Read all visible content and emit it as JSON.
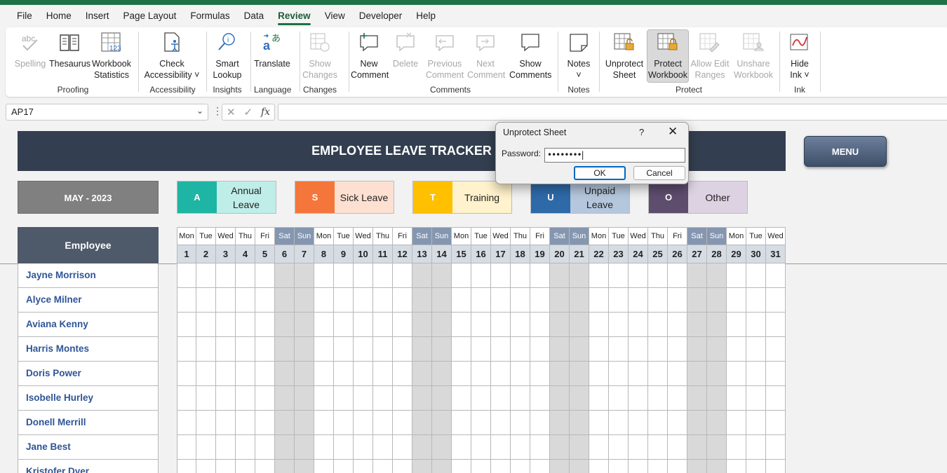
{
  "menu": [
    "File",
    "Home",
    "Insert",
    "Page Layout",
    "Formulas",
    "Data",
    "Review",
    "View",
    "Developer",
    "Help"
  ],
  "active_tab": "Review",
  "ribbon": {
    "spelling": [
      "Spelling"
    ],
    "thesaurus": [
      "Thesaurus"
    ],
    "workbook_stats": [
      "Workbook",
      "Statistics"
    ],
    "check_accessibility": [
      "Check",
      "Accessibility ˅"
    ],
    "smart_lookup": [
      "Smart",
      "Lookup"
    ],
    "translate": [
      "Translate"
    ],
    "show_changes": [
      "Show",
      "Changes"
    ],
    "new_comment": [
      "New",
      "Comment"
    ],
    "delete": [
      "Delete"
    ],
    "previous_comment": [
      "Previous",
      "Comment"
    ],
    "next_comment": [
      "Next",
      "Comment"
    ],
    "show_comments": [
      "Show",
      "Comments"
    ],
    "notes": [
      "Notes",
      "˅"
    ],
    "unprotect_sheet": [
      "Unprotect",
      "Sheet"
    ],
    "protect_workbook": [
      "Protect",
      "Workbook"
    ],
    "allow_edit_ranges": [
      "Allow Edit",
      "Ranges"
    ],
    "unshare_workbook": [
      "Unshare",
      "Workbook"
    ],
    "hide_ink": [
      "Hide",
      "Ink ˅"
    ],
    "groups": {
      "proofing": "Proofing",
      "accessibility": "Accessibility",
      "insights": "Insights",
      "language": "Language",
      "changes": "Changes",
      "comments": "Comments",
      "notes": "Notes",
      "protect": "Protect",
      "ink": "Ink"
    }
  },
  "formula_bar": {
    "name_box": "AP17",
    "formula": ""
  },
  "sheet": {
    "title": "EMPLOYEE LEAVE TRACKER",
    "menu_button": "MENU",
    "month": "MAY - 2023",
    "legend": [
      {
        "code": "A",
        "label": "Annual Leave",
        "code_color": "#1fb5a4",
        "label_color": "#bfeee8"
      },
      {
        "code": "S",
        "label": "Sick Leave",
        "code_color": "#f4763a",
        "label_color": "#fde0d2"
      },
      {
        "code": "T",
        "label": "Training",
        "code_color": "#ffc000",
        "label_color": "#fff2cc"
      },
      {
        "code": "U",
        "label": "Unpaid Leave",
        "code_color": "#2e6aa8",
        "label_color": "#b4c7dc"
      },
      {
        "code": "O",
        "label": "Other",
        "code_color": "#5e4d6d",
        "label_color": "#dcd2e2"
      }
    ],
    "employee_header": "Employee",
    "employees": [
      "Jayne Morrison",
      "Alyce Milner",
      "Aviana Kenny",
      "Harris Montes",
      "Doris Power",
      "Isobelle Hurley",
      "Donell Merrill",
      "Jane Best",
      "Kristofer Dyer"
    ],
    "weekdays": [
      "Mon",
      "Tue",
      "Wed",
      "Thu",
      "Fri",
      "Sat",
      "Sun",
      "Mon",
      "Tue",
      "Wed",
      "Thu",
      "Fri",
      "Sat",
      "Sun",
      "Mon",
      "Tue",
      "Wed",
      "Thu",
      "Fri",
      "Sat",
      "Sun",
      "Mon",
      "Tue",
      "Wed",
      "Thu",
      "Fri",
      "Sat",
      "Sun",
      "Mon",
      "Tue",
      "Wed"
    ],
    "days": [
      "1",
      "2",
      "3",
      "4",
      "5",
      "6",
      "7",
      "8",
      "9",
      "10",
      "11",
      "12",
      "13",
      "14",
      "15",
      "16",
      "17",
      "18",
      "19",
      "20",
      "21",
      "22",
      "23",
      "24",
      "25",
      "26",
      "27",
      "28",
      "29",
      "30",
      "31"
    ]
  },
  "dialog": {
    "title": "Unprotect Sheet",
    "help": "?",
    "close": "✕",
    "password_label": "Password:",
    "password_value": "••••••••|",
    "ok": "OK",
    "cancel": "Cancel"
  }
}
